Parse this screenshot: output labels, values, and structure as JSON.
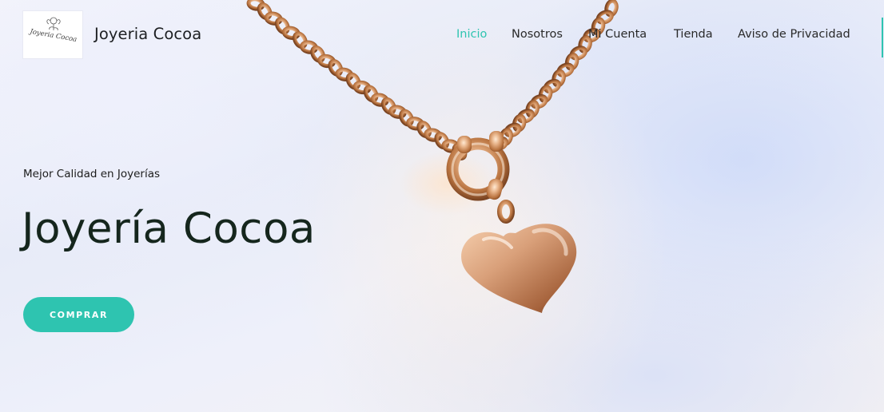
{
  "site": {
    "title": "Joyeria Cocoa",
    "logo_text": "Joyeria Cocoa"
  },
  "nav": {
    "items": [
      {
        "label": "Inicio",
        "active": true
      },
      {
        "label": "Nosotros",
        "active": false
      },
      {
        "label": "Mi Cuenta",
        "active": false
      },
      {
        "label": "Tienda",
        "active": false
      },
      {
        "label": "Aviso de Privacidad",
        "active": false
      }
    ]
  },
  "hero": {
    "tagline": "Mejor Calidad en Joyerías",
    "title": "Joyería Cocoa",
    "cta_label": "COMPRAR",
    "image": "gold-heart-necklace-photo"
  },
  "colors": {
    "accent": "#2ec4b0",
    "title_text": "#15261d",
    "body_text": "#1c1c1c",
    "gold": "#d9a06e"
  }
}
